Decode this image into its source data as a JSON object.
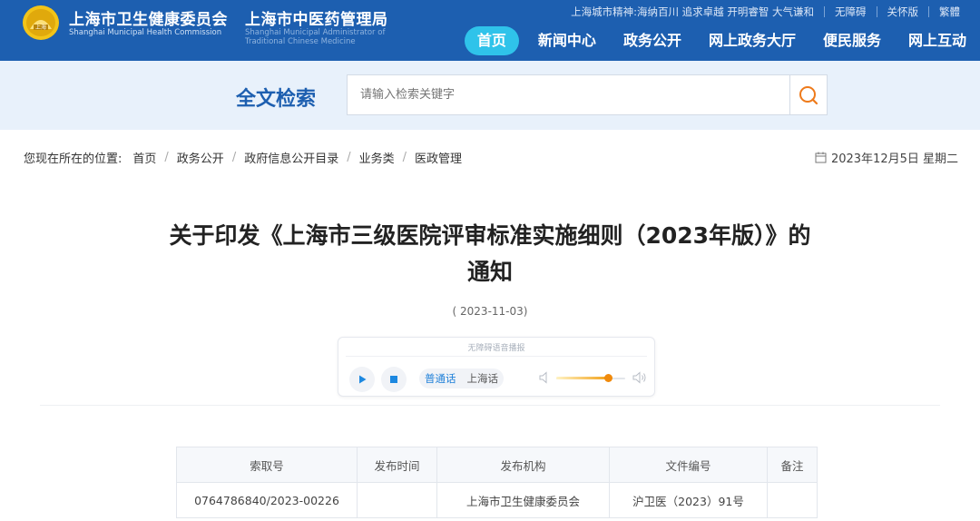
{
  "header": {
    "org1_cn": "上海市卫生健康委员会",
    "org1_en": "Shanghai Municipal Health Commission",
    "org2_cn": "上海市中医药管理局",
    "org2_en": "Shanghai Municipal Administrator of Traditional Chinese Medicine",
    "spirit_label": "上海城市精神:",
    "spirit_text": "海纳百川 追求卓越 开明睿智 大气谦和",
    "accessibility_link": "无障碍",
    "care_link": "关怀版",
    "traditional_link": "繁體",
    "brand_color": "#1d5fb0",
    "active_nav_color": "#2fc3ea"
  },
  "nav": {
    "items": [
      {
        "label": "首页",
        "active": true
      },
      {
        "label": "新闻中心"
      },
      {
        "label": "政务公开"
      },
      {
        "label": "网上政务大厅"
      },
      {
        "label": "便民服务"
      },
      {
        "label": "网上互动"
      }
    ]
  },
  "search": {
    "title": "全文检索",
    "placeholder": "请输入检索关键字",
    "button_icon": "search-icon"
  },
  "breadcrumb": {
    "prefix": "您现在所在的位置:",
    "items": [
      "首页",
      "政务公开",
      "政府信息公开目录",
      "业务类",
      "医政管理"
    ]
  },
  "today": {
    "icon": "calendar-icon",
    "text": "2023年12月5日 星期二"
  },
  "article": {
    "title_line1": "关于印发《上海市三级医院评审标准实施细则（2023年版）》的",
    "title_line2": "通知",
    "date": "( 2023-11-03)"
  },
  "player": {
    "title": "无障碍语音播报",
    "play_icon": "play-icon",
    "stop_icon": "stop-icon",
    "lang_options": [
      "普通话",
      "上海话"
    ],
    "selected_lang": "普通话",
    "volume_level": 0.75,
    "volume_low_icon": "volume-low-icon",
    "volume_high_icon": "volume-high-icon"
  },
  "info_table": {
    "headers": [
      "索取号",
      "发布时间",
      "发布机构",
      "文件编号",
      "备注"
    ],
    "rows": [
      [
        "0764786840/2023-00226",
        "",
        "上海市卫生健康委员会",
        "沪卫医（2023）91号",
        ""
      ]
    ]
  }
}
